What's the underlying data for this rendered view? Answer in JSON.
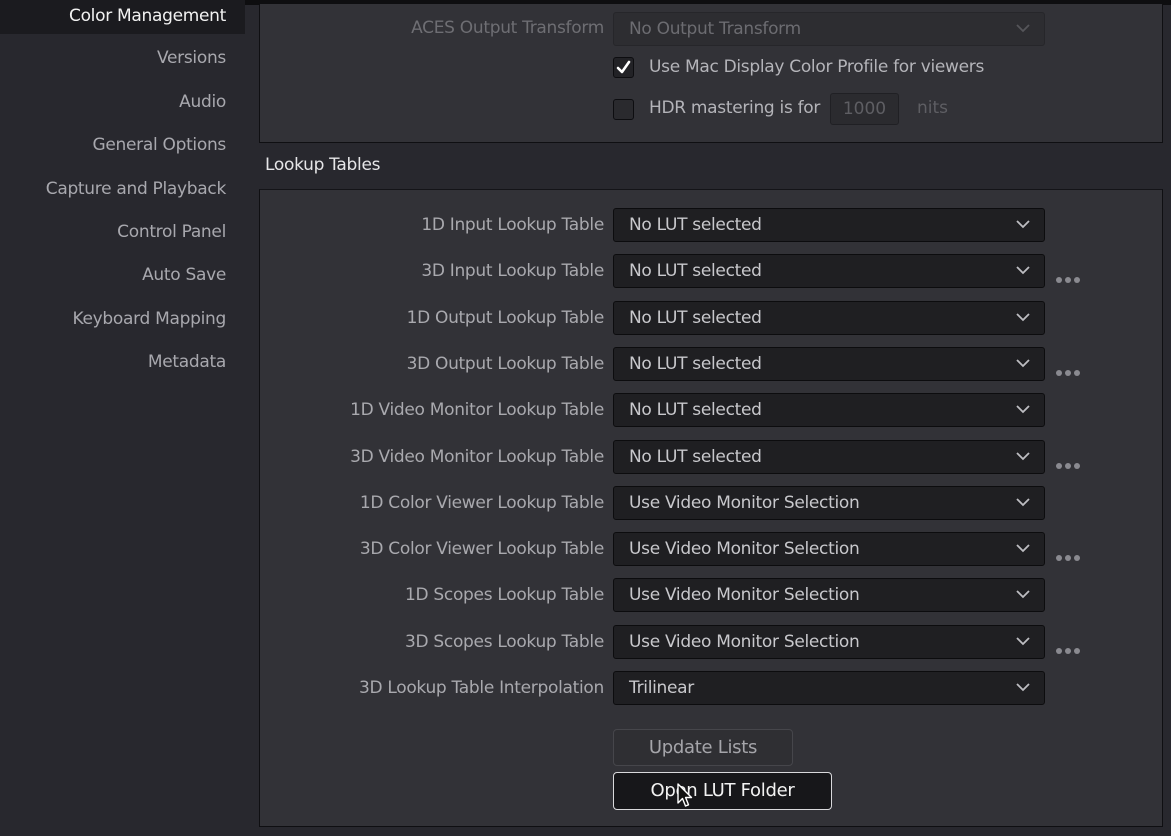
{
  "sidebar": {
    "items": [
      {
        "label": "Color Management",
        "active": true
      },
      {
        "label": "Versions"
      },
      {
        "label": "Audio"
      },
      {
        "label": "General Options"
      },
      {
        "label": "Capture and Playback"
      },
      {
        "label": "Control Panel"
      },
      {
        "label": "Auto Save"
      },
      {
        "label": "Keyboard Mapping"
      },
      {
        "label": "Metadata"
      }
    ]
  },
  "color_management": {
    "aces_output_transform": {
      "label": "ACES Output Transform",
      "value": "No Output Transform",
      "disabled": true
    },
    "use_mac_display_profile": {
      "label": "Use Mac Display Color Profile for viewers",
      "checked": true
    },
    "hdr_mastering": {
      "label": "HDR mastering is for",
      "checked": false,
      "value": "1000",
      "unit": "nits"
    }
  },
  "lookup_tables": {
    "title": "Lookup Tables",
    "rows": [
      {
        "label": "1D Input Lookup Table",
        "value": "No LUT selected",
        "more": false
      },
      {
        "label": "3D Input Lookup Table",
        "value": "No LUT selected",
        "more": true
      },
      {
        "label": "1D Output Lookup Table",
        "value": "No LUT selected",
        "more": false
      },
      {
        "label": "3D Output Lookup Table",
        "value": "No LUT selected",
        "more": true
      },
      {
        "label": "1D Video Monitor Lookup Table",
        "value": "No LUT selected",
        "more": false
      },
      {
        "label": "3D Video Monitor Lookup Table",
        "value": "No LUT selected",
        "more": true
      },
      {
        "label": "1D Color Viewer Lookup Table",
        "value": "Use Video Monitor Selection",
        "more": false
      },
      {
        "label": "3D Color Viewer Lookup Table",
        "value": "Use Video Monitor Selection",
        "more": true
      },
      {
        "label": "1D Scopes Lookup Table",
        "value": "Use Video Monitor Selection",
        "more": false
      },
      {
        "label": "3D Scopes Lookup Table",
        "value": "Use Video Monitor Selection",
        "more": true
      },
      {
        "label": "3D Lookup Table Interpolation",
        "value": "Trilinear",
        "more": false
      }
    ],
    "update_lists_label": "Update Lists",
    "open_folder_label": "Open LUT Folder"
  },
  "icons": {
    "dropdown": "chevron-down-icon",
    "more": "more-horizontal-icon",
    "check": "checkmark-icon",
    "cursor": "mouse-pointer-icon"
  }
}
